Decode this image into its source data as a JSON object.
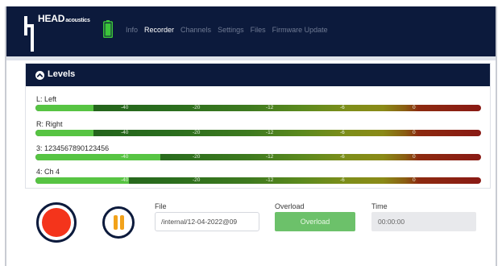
{
  "brand": {
    "name": "HEAD",
    "suffix": "acoustics"
  },
  "nav": {
    "items": [
      {
        "label": "Info",
        "active": false
      },
      {
        "label": "Recorder",
        "active": true
      },
      {
        "label": "Channels",
        "active": false
      },
      {
        "label": "Settings",
        "active": false
      },
      {
        "label": "Files",
        "active": false
      },
      {
        "label": "Firmware Update",
        "active": false
      }
    ]
  },
  "levels": {
    "title": "Levels",
    "ticks": [
      "-40",
      "-20",
      "-12",
      "-6",
      "0"
    ],
    "channels": [
      {
        "label": "L: Left",
        "level_fraction": 0.13
      },
      {
        "label": "R: Right",
        "level_fraction": 0.13
      },
      {
        "label": "3: 1234567890123456",
        "level_fraction": 0.28
      },
      {
        "label": "4: Ch 4",
        "level_fraction": 0.21
      }
    ]
  },
  "controls": {
    "file_label": "File",
    "file_value": "/internal/12-04-2022@09",
    "overload_label": "Overload",
    "overload_button": "Overload",
    "time_label": "Time",
    "time_value": "00:00:00"
  },
  "colors": {
    "navy": "#0c1a3c",
    "record_red": "#f4341b",
    "pause_orange": "#f2a21a",
    "overload_green": "#6cc16a",
    "battery_green": "#3cc43a"
  }
}
